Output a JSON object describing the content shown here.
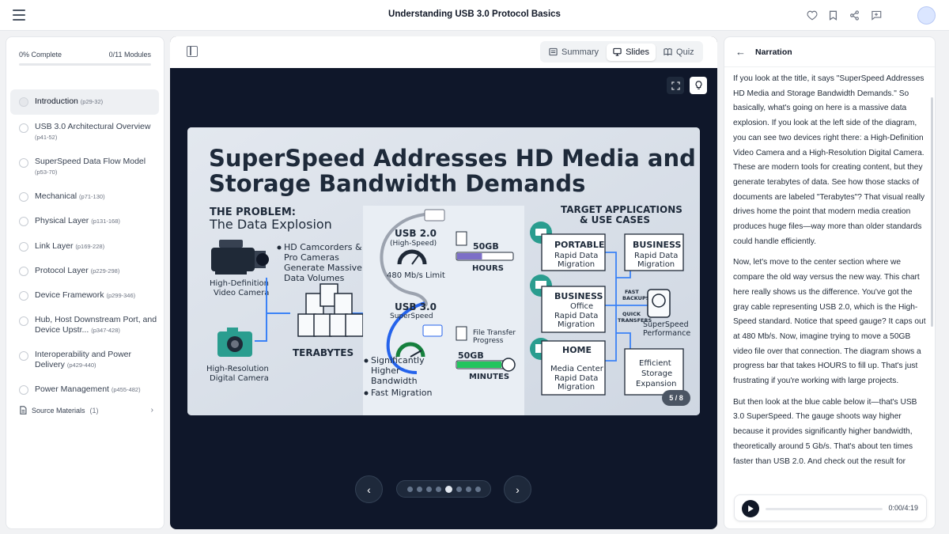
{
  "header": {
    "title": "Understanding USB 3.0 Protocol Basics",
    "actions": [
      "heart-icon",
      "bookmark-icon",
      "share-icon",
      "comment-icon"
    ]
  },
  "progress": {
    "complete_label": "0% Complete",
    "modules_label": "0/11 Modules",
    "fraction": 0
  },
  "modules": [
    {
      "title": "Introduction",
      "pages": "(p29-32)",
      "active": true
    },
    {
      "title": "USB 3.0 Architectural Overview",
      "pages": "(p41-52)"
    },
    {
      "title": "SuperSpeed Data Flow Model",
      "pages": "(p53-70)"
    },
    {
      "title": "Mechanical",
      "pages": "(p71-130)"
    },
    {
      "title": "Physical Layer",
      "pages": "(p131-168)"
    },
    {
      "title": "Link Layer",
      "pages": "(p169-228)"
    },
    {
      "title": "Protocol Layer",
      "pages": "(p229-298)"
    },
    {
      "title": "Device Framework",
      "pages": "(p299-346)"
    },
    {
      "title": "Hub, Host Downstream Port, and Device Upstr...",
      "pages": "(p347-428)"
    },
    {
      "title": "Interoperability and Power Delivery",
      "pages": "(p429-440)"
    },
    {
      "title": "Power Management",
      "pages": "(p455-482)"
    }
  ],
  "sources": {
    "label": "Source Materials",
    "count": "(1)"
  },
  "view_tabs": {
    "summary": "Summary",
    "slides": "Slides",
    "quiz": "Quiz",
    "selected": "slides"
  },
  "slide": {
    "title_line1": "SuperSpeed Addresses HD Media and",
    "title_line2": "Storage Bandwidth Demands",
    "problem_heading1": "THE PROBLEM:",
    "problem_heading2": "The Data Explosion",
    "camcorder_bullet": [
      "HD Camcorders &",
      "Pro Cameras",
      "Generate Massive",
      "Data Volumes"
    ],
    "video_camera_label": [
      "High-Definition",
      "Video Camera"
    ],
    "digital_camera_label": [
      "High-Resolution",
      "Digital Camera"
    ],
    "terabytes_doc_label": "Terabytes",
    "terabytes_label": "TERABYTES",
    "usb2_title": "USB 2.0",
    "usb2_sub": "(High-Speed)",
    "usb2_limit": "480 Mb/s Limit",
    "usb2_file": "50GB",
    "usb2_time": "HOURS",
    "usb3_title": "USB 3.0",
    "usb3_sub": "SuperSpeed",
    "usb3_transfer": [
      "File Transfer",
      "Progress"
    ],
    "usb3_file": "50GB",
    "usb3_time": "MINUTES",
    "usb3_bullets": [
      "Significantly",
      "Higher",
      "Bandwidth",
      "Fast Migration"
    ],
    "targets_heading": [
      "TARGET APPLICATIONS",
      "& USE CASES"
    ],
    "target_boxes": [
      {
        "title": "PORTABLE",
        "sub": [
          "Rapid Data",
          "Migration"
        ]
      },
      {
        "title": "BUSINESS",
        "sub": [
          "Rapid Data",
          "Migration"
        ]
      },
      {
        "title": "BUSINESS",
        "sub": [
          "Office",
          "Rapid Data",
          "Migration"
        ]
      },
      {
        "title": "HOME",
        "sub": [
          "Media Center",
          "Rapid Data",
          "Migration"
        ]
      },
      {
        "title": "",
        "sub": [
          "Efficient",
          "Storage",
          "Expansion"
        ]
      }
    ],
    "fast_backups": [
      "FAST",
      "BACKUPS"
    ],
    "quick_transfers": [
      "QUICK",
      "TRANSFERS"
    ],
    "superspeed_performance": [
      "SuperSpeed",
      "Performance"
    ],
    "usb2_progress": 0.45,
    "usb3_progress": 0.85
  },
  "slide_counter": "5 / 8",
  "slide_dots": {
    "total": 8,
    "current": 5
  },
  "narration": {
    "title": "Narration",
    "paragraphs": [
      "If you look at the title, it says \"SuperSpeed Addresses HD Media and Storage Bandwidth Demands.\" So basically, what's going on here is a massive data explosion.  If you look at the left side of the diagram, you can see two devices right there: a High-Definition Video Camera and a High-Resolution Digital Camera.  These are modern tools for creating content, but they generate terabytes of data.  See how those stacks of documents are labeled \"Terabytes\"?  That visual really drives home the point that modern media creation produces huge files—way more than older standards could handle efficiently.",
      "Now, let's move to the center section where we compare the old way versus the new way.  This chart here really shows us the difference.  You've got the gray cable representing USB 2.0, which is the High-Speed standard.  Notice that speed gauge?  It caps out at 480 Mb/s.  Now, imagine trying to move a 50GB video file over that connection.  The diagram shows a progress bar that takes HOURS to fill up.  That's just frustrating if you're working with large projects.",
      "But then look at the blue cable below it—that's USB 3.0 SuperSpeed.  The gauge shoots way higher because it provides significantly higher bandwidth, theoretically around 5 Gb/s.  That's about ten times faster than USB 2.0.  And check out the result for"
    ]
  },
  "player": {
    "time": "0:00/4:19",
    "progress": 0
  }
}
